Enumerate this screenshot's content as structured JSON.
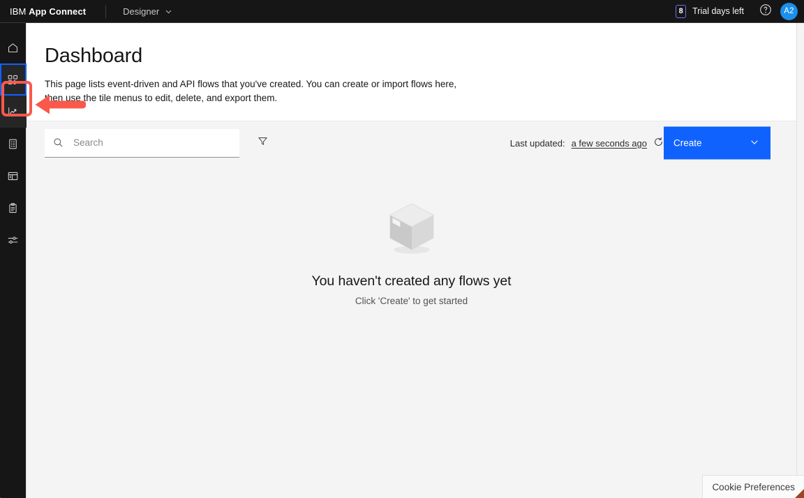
{
  "header": {
    "brand_ibm": "IBM",
    "brand_product": "App Connect",
    "switcher_label": "Designer",
    "switcher_icon": "chevron-down-icon",
    "trial_days": "8",
    "trial_label": "Trial days left",
    "help_icon": "help-circle-icon",
    "avatar_initials": "A2",
    "accent_avatar": "#1a8fec",
    "trial_badge_border": "#6f6ff0"
  },
  "sidebar": {
    "items": [
      {
        "name": "sidebar-item-home",
        "icon": "home-icon",
        "state": "default"
      },
      {
        "name": "sidebar-item-dashboard",
        "icon": "grid-apps-icon",
        "state": "focused"
      },
      {
        "name": "sidebar-item-analytics",
        "icon": "chart-line-icon",
        "state": "annotated"
      },
      {
        "name": "sidebar-item-catalog",
        "icon": "list-box-icon",
        "state": "default"
      },
      {
        "name": "sidebar-item-apis",
        "icon": "layout-panel-icon",
        "state": "default"
      },
      {
        "name": "sidebar-item-tasks",
        "icon": "clipboard-icon",
        "state": "default"
      },
      {
        "name": "sidebar-item-settings",
        "icon": "sliders-icon",
        "state": "default"
      }
    ]
  },
  "annotation": {
    "color": "#f9584b",
    "shape": "arrow-left",
    "target": "sidebar-item-analytics"
  },
  "page": {
    "title": "Dashboard",
    "description": "This page lists event-driven and API flows that you've created. You can create or import flows here, then use the tile menus to edit, delete, and export them."
  },
  "toolbar": {
    "search_placeholder": "Search",
    "search_value": "",
    "search_icon": "search-icon",
    "filter_icon": "filter-funnel-icon",
    "last_updated_label": "Last updated:",
    "last_updated_value": "a few seconds ago",
    "refresh_icon": "refresh-icon",
    "create_label": "Create",
    "create_chevron": "chevron-down-icon",
    "create_color": "#0f62fe"
  },
  "empty_state": {
    "illustration": "empty-box-icon",
    "title": "You haven't created any flows yet",
    "subtitle": "Click 'Create' to get started"
  },
  "cookie_banner": {
    "label": "Cookie Preferences"
  }
}
